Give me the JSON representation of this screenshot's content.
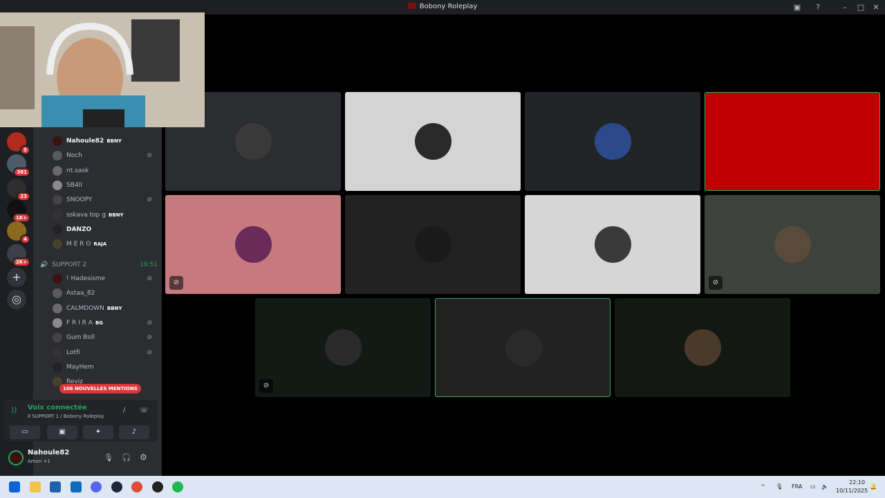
{
  "titlebar": {
    "title": "Bobony Roleplay"
  },
  "guilds": [
    {
      "badge": "5",
      "color": "#b02a1e"
    },
    {
      "badge": "381",
      "color": "#4c5a6a"
    },
    {
      "badge": "23",
      "color": "#2e2e2e"
    },
    {
      "badge": "1K+",
      "color": "#111111"
    },
    {
      "badge": "4",
      "color": "#8a6a1f"
    },
    {
      "badge": "2K+",
      "color": "#3a4048"
    }
  ],
  "members_upper": [
    {
      "name": "Nahoule82",
      "tag": "BBNY",
      "highlight": true,
      "muted": false
    },
    {
      "name": "Noch",
      "tag": "",
      "highlight": false,
      "muted": true
    },
    {
      "name": "nt.sask",
      "tag": "",
      "highlight": false,
      "muted": false
    },
    {
      "name": "SB4ll",
      "tag": "",
      "highlight": false,
      "muted": false
    },
    {
      "name": "SNOOPY",
      "tag": "",
      "highlight": false,
      "muted": true
    },
    {
      "name": "sskava top g",
      "tag": "BBNY",
      "highlight": false,
      "muted": false
    },
    {
      "name": "DANZO",
      "tag": "",
      "highlight": true,
      "muted": false
    },
    {
      "name": "M E R O",
      "tag": "RAJA",
      "highlight": false,
      "muted": false
    }
  ],
  "channel": {
    "name": "SUPPORT 2",
    "time": "19:51"
  },
  "members_lower": [
    {
      "name": "! Hadesisme",
      "tag": "",
      "muted": true
    },
    {
      "name": "Astaa_82",
      "tag": "",
      "muted": false
    },
    {
      "name": "CALMDOWN",
      "tag": "BBNY",
      "muted": false
    },
    {
      "name": "F R I R A",
      "tag": "BG",
      "muted": true
    },
    {
      "name": "Gum Boll",
      "tag": "",
      "muted": true
    },
    {
      "name": "Lotfi",
      "tag": "",
      "muted": true
    },
    {
      "name": "MayHem",
      "tag": "",
      "muted": false
    },
    {
      "name": "Reviz",
      "tag": "",
      "muted": false
    }
  ],
  "mentions": "106 NOUVELLES MENTIONS",
  "voice": {
    "status": "Voix connectée",
    "location": "Il SUPPORT 1 / Bobony Roleplay"
  },
  "user": {
    "name": "Nahoule82",
    "status": "Amon +1"
  },
  "tiles": [
    {
      "bg": "#2b2d31",
      "avatar": "#3a3a3a",
      "muted": false,
      "speaking": false
    },
    {
      "bg": "#d4d4d4",
      "avatar": "#2a2a2a",
      "muted": false,
      "speaking": false
    },
    {
      "bg": "#232428",
      "avatar": "#2c4a8a",
      "muted": false,
      "speaking": false
    },
    {
      "bg": "#c00000",
      "avatar": "",
      "muted": false,
      "speaking": true
    },
    {
      "bg": "#c77a7d",
      "avatar": "#6a2a5a",
      "muted": true,
      "speaking": false
    },
    {
      "bg": "#222222",
      "avatar": "#1a1a1a",
      "muted": false,
      "speaking": false
    },
    {
      "bg": "#d6d6d6",
      "avatar": "#3a3a3a",
      "muted": false,
      "speaking": false
    },
    {
      "bg": "#3e423d",
      "avatar": "#5a4a3a",
      "muted": true,
      "speaking": false
    },
    {
      "bg": "#121a16",
      "avatar": "#2a2a2a",
      "muted": true,
      "speaking": false
    },
    {
      "bg": "#222222",
      "avatar": "#2a2a2a",
      "muted": false,
      "speaking": true
    },
    {
      "bg": "#141812",
      "avatar": "#4a3a2a",
      "muted": false,
      "speaking": false
    }
  ],
  "taskbar": {
    "lang": "FRA",
    "time": "22:10",
    "date": "10/11/2025"
  }
}
